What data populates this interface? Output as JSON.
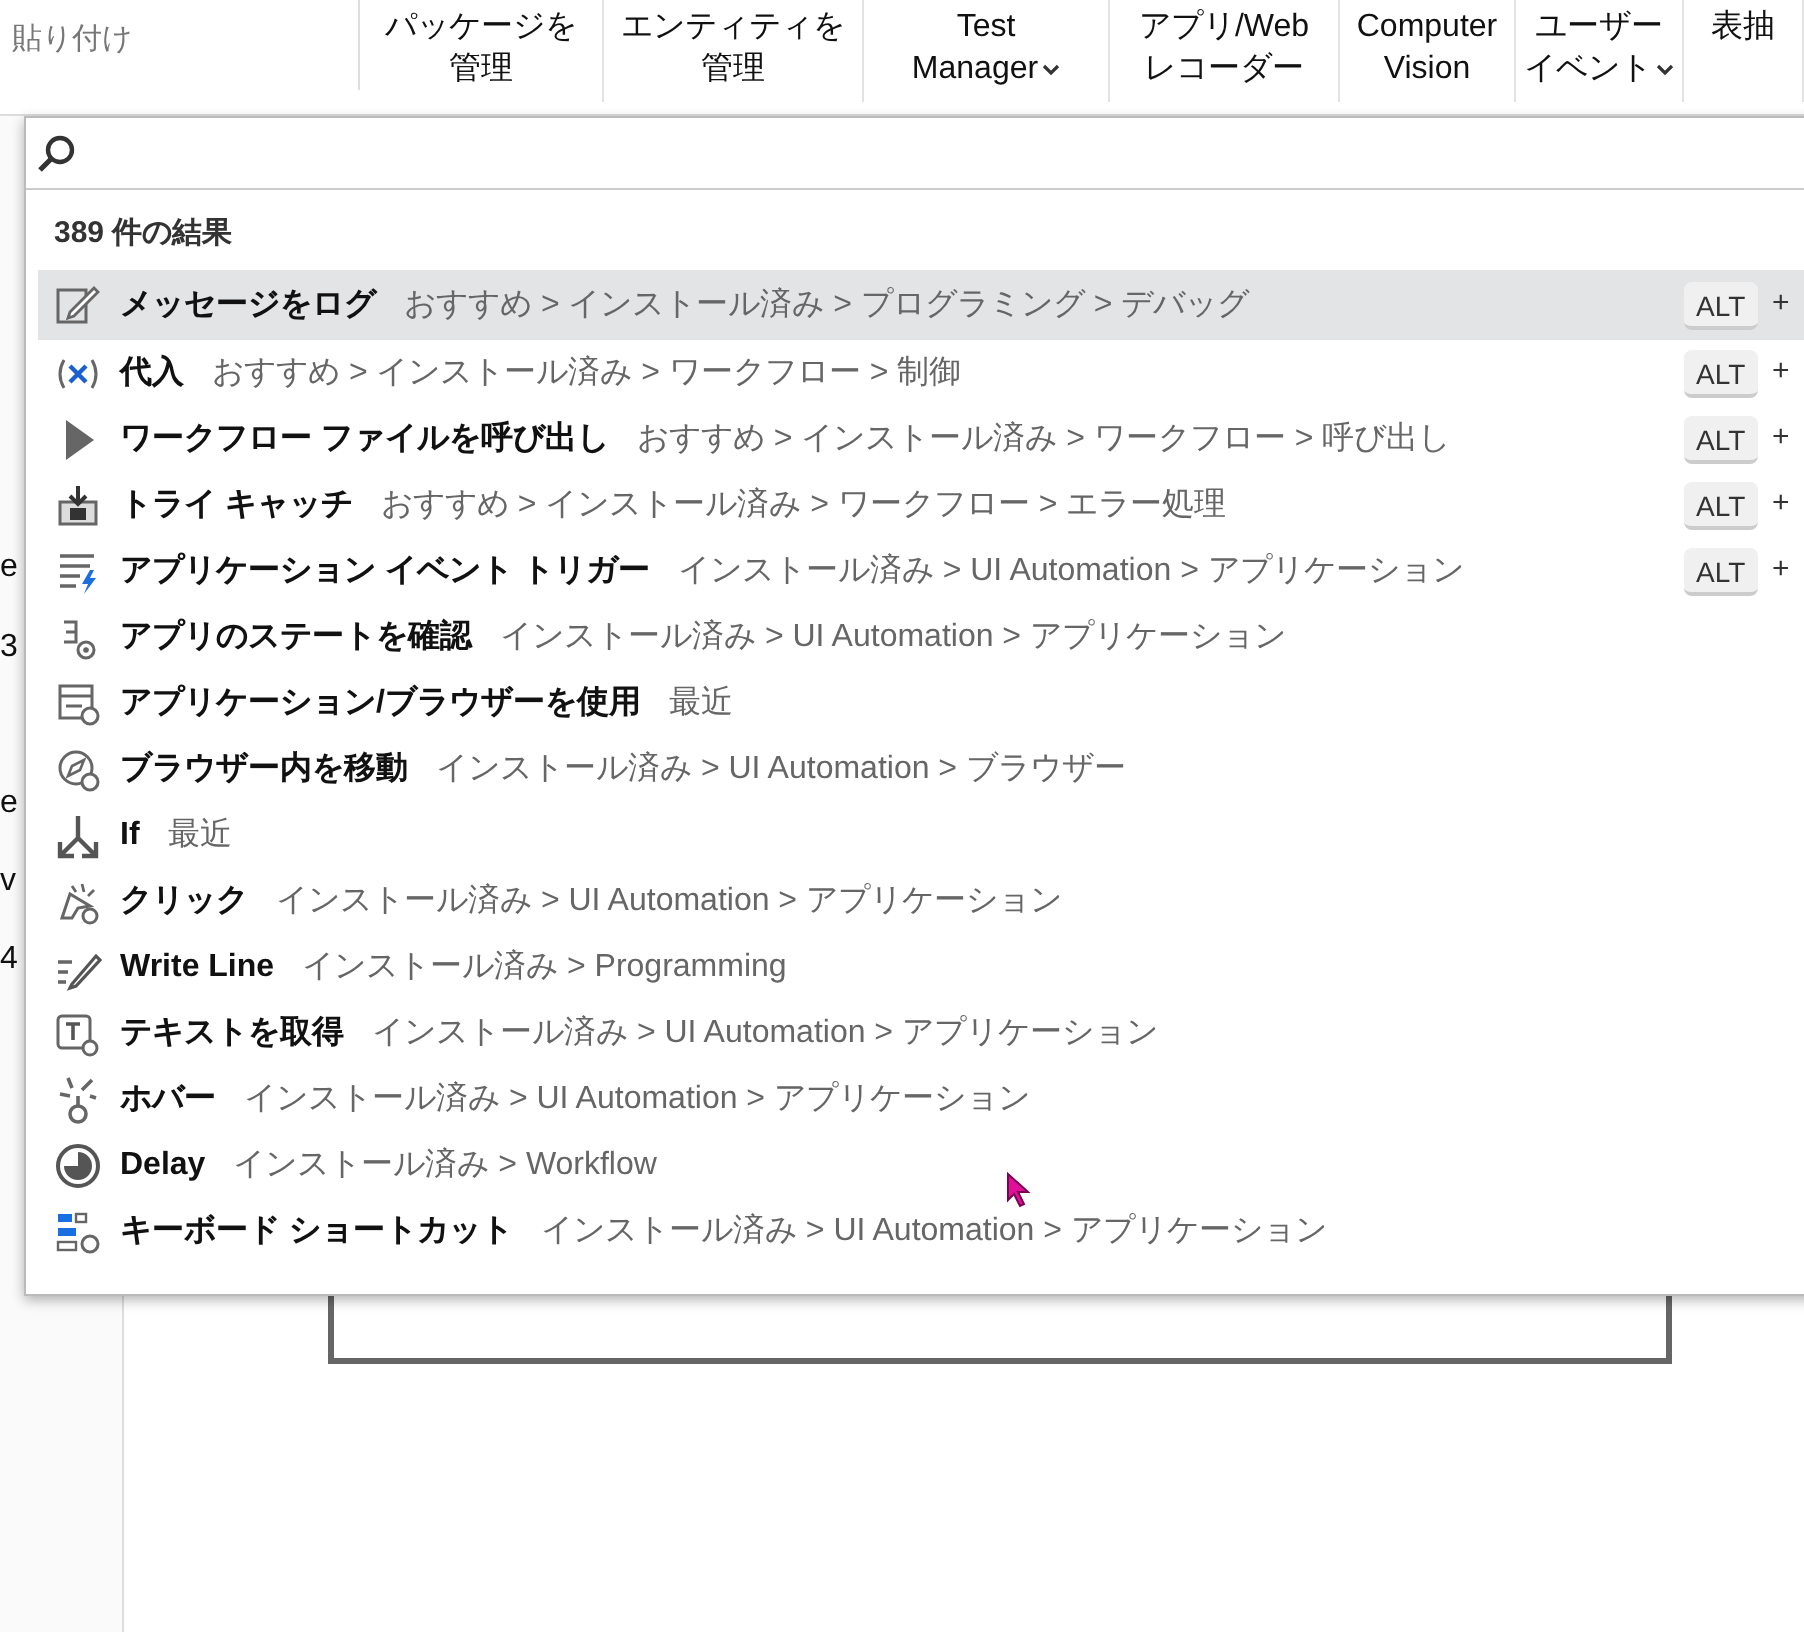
{
  "ribbon": {
    "paste_label": "貼り付け",
    "buttons": [
      {
        "line1": "パッケージを",
        "line2": "管理",
        "dropdown": false
      },
      {
        "line1": "エンティティを",
        "line2": "管理",
        "dropdown": false
      },
      {
        "line1": "Test",
        "line2": "Manager",
        "dropdown": true
      },
      {
        "line1": "アプリ/Web",
        "line2": "レコーダー",
        "dropdown": false
      },
      {
        "line1": "Computer",
        "line2": "Vision",
        "dropdown": false
      },
      {
        "line1": "ユーザー",
        "line2": "イベント",
        "dropdown": true
      },
      {
        "line1": "表抽",
        "dropdown": false
      }
    ]
  },
  "background_fragments": [
    "e",
    "3",
    "e",
    "v",
    "4"
  ],
  "search": {
    "result_count": "389 件の結果"
  },
  "results": [
    {
      "kind": "log",
      "name": "メッセージをログ",
      "path": "おすすめ > インストール済み > プログラミング > デバッグ",
      "shortcut": "ALT",
      "plus": "+",
      "selected": true
    },
    {
      "kind": "assign",
      "name": "代入",
      "path": "おすすめ > インストール済み > ワークフロー > 制御",
      "shortcut": "ALT",
      "plus": "+",
      "selected": false
    },
    {
      "kind": "invoke",
      "name": "ワークフロー ファイルを呼び出し",
      "path": "おすすめ > インストール済み > ワークフロー > 呼び出し",
      "shortcut": "ALT",
      "plus": "+",
      "selected": false
    },
    {
      "kind": "try",
      "name": "トライ キャッチ",
      "path": "おすすめ > インストール済み > ワークフロー > エラー処理",
      "shortcut": "ALT",
      "plus": "+",
      "selected": false
    },
    {
      "kind": "trigger",
      "name": "アプリケーション イベント トリガー",
      "path": "インストール済み > UI Automation > アプリケーション",
      "shortcut": "ALT",
      "plus": "+",
      "selected": false
    },
    {
      "kind": "state",
      "name": "アプリのステートを確認",
      "path": "インストール済み > UI Automation > アプリケーション",
      "selected": false
    },
    {
      "kind": "browser",
      "name": "アプリケーション/ブラウザーを使用",
      "path": "最近",
      "selected": false
    },
    {
      "kind": "navigate",
      "name": "ブラウザー内を移動",
      "path": "インストール済み > UI Automation > ブラウザー",
      "selected": false
    },
    {
      "kind": "if",
      "name": "If",
      "path": "最近",
      "selected": false
    },
    {
      "kind": "click",
      "name": "クリック",
      "path": "インストール済み > UI Automation > アプリケーション",
      "selected": false
    },
    {
      "kind": "write",
      "name": "Write Line",
      "path": "インストール済み > Programming",
      "selected": false
    },
    {
      "kind": "gettext",
      "name": "テキストを取得",
      "path": "インストール済み > UI Automation > アプリケーション",
      "selected": false
    },
    {
      "kind": "hover",
      "name": "ホバー",
      "path": "インストール済み > UI Automation > アプリケーション",
      "selected": false
    },
    {
      "kind": "delay",
      "name": "Delay",
      "path": "インストール済み > Workflow",
      "selected": false
    },
    {
      "kind": "shortcut",
      "name": "キーボード ショートカット",
      "path": "インストール済み > UI Automation > アプリケーション",
      "selected": false
    }
  ]
}
